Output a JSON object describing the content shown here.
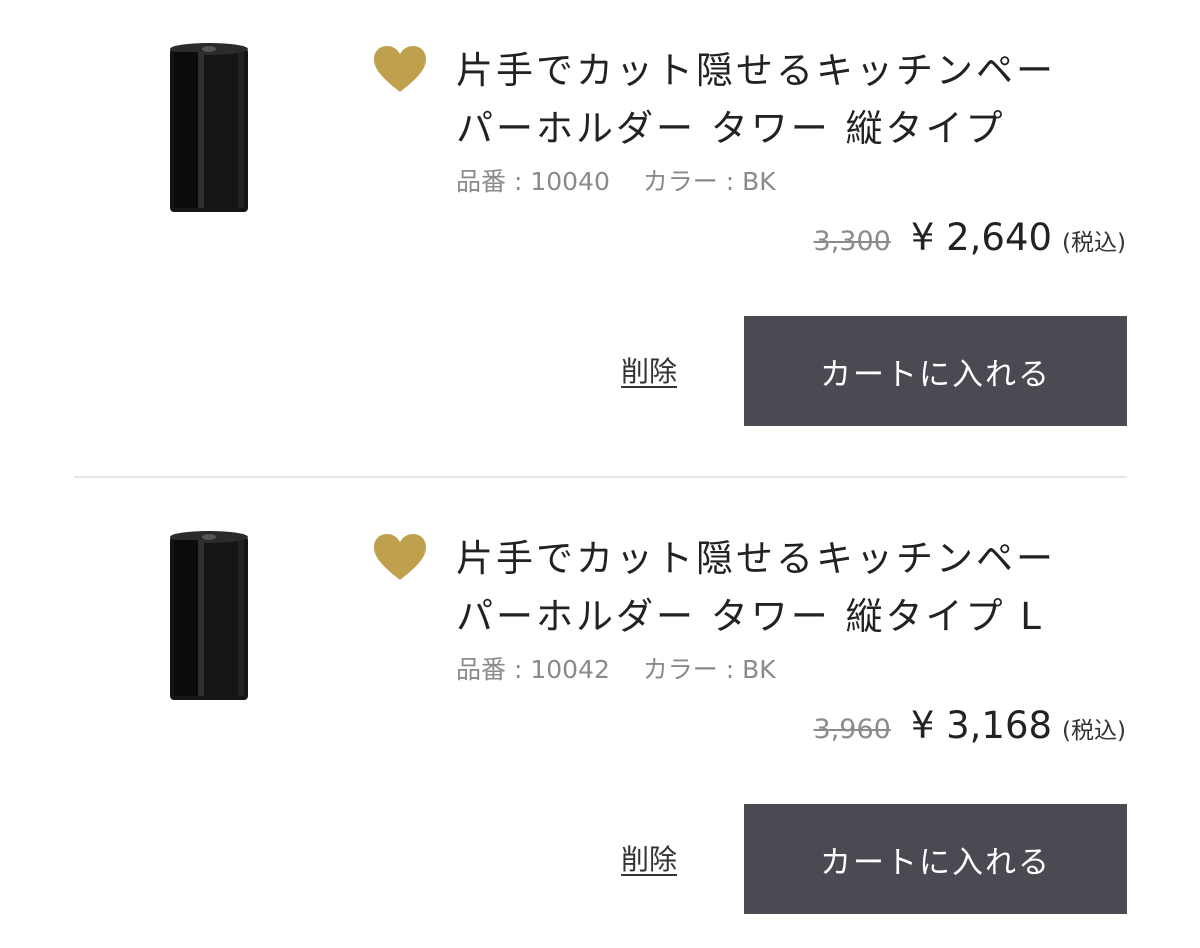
{
  "accent_color": "#BFA14D",
  "button_color": "#4A4A52",
  "items": [
    {
      "title_line1": "片手でカット隠せるキッチンペー",
      "title_line2": "パーホルダー タワー 縦タイプ",
      "meta": "品番 : 10040　 カラー : BK",
      "original_price": "3,300",
      "price": "¥ 2,640",
      "tax_label": "(税込)",
      "delete_label": "削除",
      "cart_label": "カートに入れる",
      "favorite_icon": "heart-icon"
    },
    {
      "title_line1": "片手でカット隠せるキッチンペー",
      "title_line2": "パーホルダー タワー 縦タイプ L",
      "meta": "品番 : 10042　 カラー : BK",
      "original_price": "3,960",
      "price": "¥ 3,168",
      "tax_label": "(税込)",
      "delete_label": "削除",
      "cart_label": "カートに入れる",
      "favorite_icon": "heart-icon"
    }
  ]
}
